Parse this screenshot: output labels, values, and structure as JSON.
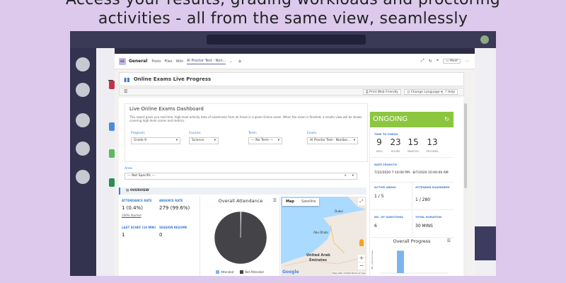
{
  "headline": {
    "line1": "Access your results, grading workloads and proctoring",
    "line2": "activities - all from the same view, seamlessly"
  },
  "teams": {
    "channel_initials": "Te",
    "team_icon_text": "GE",
    "team_name": "General",
    "tabs": [
      "Posts",
      "Files",
      "Wiki",
      "AI Proctor Test - Non..."
    ],
    "active_tab_index": 3,
    "add_tab": "+",
    "header_icons": [
      "⤢",
      "↻",
      "⌖"
    ],
    "meet_label": "Meet",
    "more": "⋯"
  },
  "page": {
    "title": "Online Exams Live Progress",
    "menu_icon": "☰",
    "toolbar_buttons": [
      "Print Web Friendly",
      "Change Language",
      "Help"
    ]
  },
  "dashboard": {
    "title": "Live Online Exams Dashboard",
    "description": "This report gives you real time, high-level activity data of examinees from all Areas in a given Online exam. When the exam is finished, a results view will be shown covering high-level scores and metrics.",
    "filters": [
      {
        "label": "Program:",
        "value": "Grade 9"
      },
      {
        "label": "Course:",
        "value": "Science"
      },
      {
        "label": "Term:",
        "value": "--- No Term ---"
      },
      {
        "label": "Exam:",
        "value": "AI Proctor Test - NonSec..."
      }
    ],
    "area_label": "Area:",
    "area_value": "--- Not Specific ---",
    "clear_symbol": "×",
    "dropdown_symbol": "▾"
  },
  "overview": {
    "label": "OVERVIEW",
    "kpis": [
      {
        "label": "ATTENDANCE RATE",
        "value": "1 (0.4%)",
        "link": "100% Started"
      },
      {
        "label": "ABSENCE RATE",
        "value": "279 (99.6%)"
      },
      {
        "label": "LAST SCHEF (10 MIN)",
        "value": "1"
      },
      {
        "label": "SESSION RESUME",
        "value": "0"
      }
    ],
    "attendance_chart": {
      "title": "Overall Attendance",
      "menu": "☰",
      "legend": [
        {
          "name": "Attended",
          "color": "#7cb5ec"
        },
        {
          "name": "Not Attended",
          "color": "#434348"
        }
      ]
    }
  },
  "map": {
    "tabs": [
      "Map",
      "Satellite"
    ],
    "fullscreen": "⤢",
    "zoom_in": "+",
    "zoom_out": "−",
    "labels": {
      "dubai": "Dubai",
      "abu_dhabi": "Abu Dhabi",
      "uae1": "United Arab",
      "uae2": "Emirates"
    },
    "google": "Google",
    "footer": "Map data ©2020  Terms of Use"
  },
  "status_panel": {
    "state": "ONGOING",
    "refresh_icon": "↻",
    "time_to_finish_label": "TIME TO FINISH",
    "countdown": [
      {
        "value": "9",
        "unit": "DAYS"
      },
      {
        "value": "23",
        "unit": "HOURS"
      },
      {
        "value": "15",
        "unit": "MINUTES"
      },
      {
        "value": "13",
        "unit": "SECONDS"
      }
    ],
    "date_label": "DATE FROM/TO",
    "date_value": "7/22/2020 7:10:00 PM - 8/7/2020 10:00:00 AM",
    "stats": [
      {
        "label": "ACTIVE AREAS",
        "value": "1 / 5"
      },
      {
        "label": "ATTENDED EXAMINEES",
        "value": "1 / 280"
      },
      {
        "label": "NO. OF QUESTIONS",
        "value": "6"
      },
      {
        "label": "TOTAL DURATION",
        "value": "30 MINS"
      }
    ],
    "progress_chart": {
      "title": "Overall Progress",
      "menu": "☰",
      "ylabel": "No. of Examinees"
    }
  },
  "colors": {
    "accent": "#3a7bd5",
    "ongoing_green": "#8cc63f",
    "pie_attended": "#7cb5ec",
    "pie_not_attended": "#434348",
    "progress_bar": "#7cb5ec"
  },
  "chart_data": [
    {
      "type": "pie",
      "title": "Overall Attendance",
      "categories": [
        "Attended",
        "Not Attended"
      ],
      "values": [
        1,
        279
      ]
    },
    {
      "type": "bar",
      "title": "Overall Progress",
      "ylabel": "No. of Examinees",
      "ylim": [
        0,
        300
      ],
      "series": [
        {
          "values": [
            250
          ]
        }
      ]
    }
  ]
}
